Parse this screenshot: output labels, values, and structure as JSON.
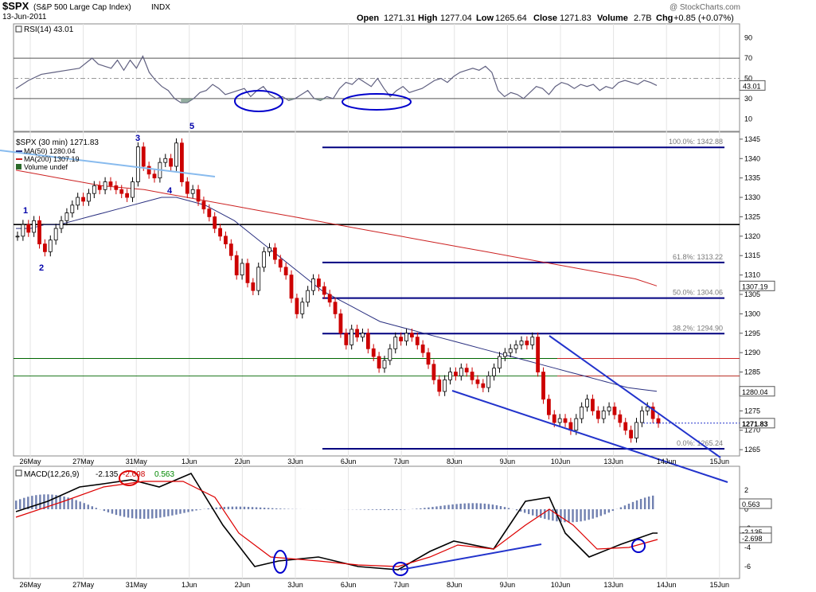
{
  "header": {
    "symbol": "$SPX",
    "name": "(S&P 500 Large Cap Index)",
    "exchange": "INDX",
    "date": "13-Jun-2011",
    "watermark": "@ StockCharts.com",
    "ohlc_text": {
      "open_label": "Open",
      "open": "1271.31",
      "high_label": "High",
      "high": "1277.04",
      "low_label": "Low",
      "low": "1265.64",
      "close_label": "Close",
      "close": "1271.83",
      "volume_label": "Volume",
      "volume": "2.7B",
      "chg_label": "Chg",
      "chg": "+0.85 (+0.07%)"
    }
  },
  "colors": {
    "up": "#000000",
    "down": "#cc0000",
    "ma50": "#2a3080",
    "ma200": "#cc2222",
    "fib": "#000080",
    "trend": "#2233cc",
    "oldtrend": "#88bbee",
    "rsi": "#606080",
    "rsi_fill": "#7a9a8a",
    "macd": "#000000",
    "signal": "#dd0000",
    "hist": "#7080b0",
    "annot_red": "#dd0000",
    "annot_blue": "#0000cc"
  },
  "chart_data": [
    {
      "type": "line",
      "panel": "rsi",
      "legend": "RSI(14) 43.01",
      "ylim": [
        0,
        100
      ],
      "yticks": [
        10,
        30,
        50,
        70,
        90
      ],
      "levels": [
        30,
        50,
        70
      ],
      "last_value": "43.01",
      "x_index": [
        0,
        4,
        8,
        12,
        16,
        20,
        24,
        26,
        28,
        30,
        32,
        34,
        36,
        38,
        40,
        42,
        44,
        46,
        48,
        50,
        52,
        54,
        56,
        58,
        60,
        62,
        64,
        66,
        68,
        70,
        72,
        74,
        76,
        78,
        80,
        82,
        84,
        86,
        88,
        90,
        92,
        94,
        96,
        98,
        100,
        102,
        104,
        106,
        108,
        110,
        112,
        114,
        116,
        118,
        120,
        122,
        124,
        126,
        128,
        130,
        132,
        134,
        136,
        138,
        140,
        142,
        144,
        146,
        148,
        150,
        152,
        154,
        156,
        158,
        160,
        162,
        164,
        166,
        168,
        170,
        172,
        174,
        176,
        178,
        180,
        182,
        184,
        186,
        188,
        190,
        192,
        194,
        196,
        198,
        200,
        202
      ],
      "values": [
        40,
        48,
        54,
        56,
        58,
        60,
        70,
        64,
        62,
        60,
        68,
        58,
        68,
        60,
        72,
        56,
        48,
        42,
        38,
        30,
        26,
        26,
        30,
        36,
        38,
        44,
        40,
        34,
        36,
        38,
        40,
        32,
        38,
        42,
        34,
        30,
        32,
        28,
        30,
        34,
        38,
        30,
        28,
        32,
        30,
        40,
        46,
        44,
        50,
        46,
        42,
        50,
        40,
        32,
        38,
        42,
        36,
        38,
        40,
        44,
        48,
        50,
        46,
        52,
        56,
        58,
        60,
        58,
        62,
        56,
        38,
        32,
        36,
        34,
        30,
        36,
        42,
        40,
        34,
        42,
        46,
        44,
        40,
        44,
        42,
        44,
        38,
        42,
        40,
        46,
        48,
        46,
        44,
        48,
        46,
        43
      ]
    },
    {
      "type": "candlestick",
      "panel": "price",
      "title": "$SPX (30 min) 1271.83",
      "legend": [
        {
          "label": "MA(50) 1280.04"
        },
        {
          "label": "MA(200) 1307.19"
        },
        {
          "label": "Volume undef"
        }
      ],
      "ylim": [
        1264,
        1346
      ],
      "yticks": [
        1265,
        1270,
        1275,
        1280,
        1285,
        1290,
        1295,
        1300,
        1305,
        1310,
        1315,
        1320,
        1325,
        1330,
        1335,
        1340,
        1345
      ],
      "x_labels": [
        "26May",
        "27May",
        "31May",
        "1Jun",
        "2Jun",
        "3Jun",
        "6Jun",
        "7Jun",
        "8Jun",
        "9Jun",
        "10Jun",
        "13Jun",
        "14Jun",
        "15Jun"
      ],
      "x_label_index": [
        0,
        13,
        26,
        39,
        52,
        65,
        78,
        91,
        104,
        117,
        130,
        143,
        156,
        169
      ],
      "close": [
        1320,
        1323,
        1321,
        1324,
        1318,
        1316,
        1319,
        1322,
        1324,
        1326,
        1328,
        1330,
        1329,
        1331,
        1333,
        1332,
        1334,
        1333,
        1332,
        1331,
        1330,
        1334,
        1343,
        1338,
        1336,
        1335,
        1339,
        1340,
        1338,
        1344,
        1334,
        1331,
        1332,
        1329,
        1327,
        1325,
        1322,
        1320,
        1318,
        1315,
        1310,
        1313,
        1308,
        1306,
        1312,
        1316,
        1317,
        1314,
        1312,
        1310,
        1304,
        1300,
        1303,
        1306,
        1309,
        1307,
        1305,
        1303,
        1300,
        1295,
        1292,
        1296,
        1294,
        1295,
        1291,
        1289,
        1286,
        1288,
        1291,
        1294,
        1293,
        1295,
        1294,
        1292,
        1290,
        1287,
        1283,
        1280,
        1283,
        1285,
        1284,
        1286,
        1285,
        1283,
        1282,
        1281,
        1284,
        1286,
        1289,
        1290,
        1291,
        1292,
        1293,
        1292,
        1294,
        1285,
        1278,
        1274,
        1272,
        1273,
        1272,
        1270,
        1273,
        1276,
        1278,
        1275,
        1273,
        1275,
        1276,
        1274,
        1272,
        1270,
        1268,
        1272,
        1275,
        1276,
        1273,
        1271.83
      ],
      "ma50": [
        1322,
        1322,
        1323,
        1323,
        1324,
        1325,
        1326,
        1327,
        1328,
        1329,
        1330,
        1330,
        1329,
        1328,
        1326,
        1324,
        1321,
        1318,
        1315,
        1312,
        1309,
        1306,
        1304,
        1302,
        1300,
        1298,
        1297,
        1296,
        1295,
        1294,
        1293,
        1292,
        1291,
        1290,
        1289,
        1288,
        1287,
        1286,
        1285,
        1284,
        1283,
        1282,
        1281,
        1280.5,
        1280.04
      ],
      "ma200": [
        1337,
        1336,
        1335,
        1334,
        1333,
        1332.5,
        1332,
        1331,
        1330,
        1329,
        1328,
        1327,
        1326,
        1325,
        1324,
        1323,
        1322,
        1321,
        1320,
        1319,
        1318,
        1317,
        1316,
        1315,
        1314,
        1313,
        1312,
        1311,
        1310,
        1309,
        1307.19
      ],
      "fibonacci": [
        {
          "label": "100.0%: 1342.88",
          "value": 1342.88
        },
        {
          "label": "61.8%: 1313.22",
          "value": 1313.22
        },
        {
          "label": "50.0%: 1304.06",
          "value": 1304.06
        },
        {
          "label": "38.2%: 1294.90",
          "value": 1294.9
        },
        {
          "label": "0.0%: 1265.24",
          "value": 1265.24
        }
      ],
      "horizontal_lines": [
        {
          "value": 1323,
          "color": "#000000"
        },
        {
          "value": 1288.5,
          "color": "#006600"
        },
        {
          "value": 1284,
          "color": "#006600"
        },
        {
          "value": 1288.5,
          "color": "#cc2222"
        },
        {
          "value": 1284,
          "color": "#cc2222"
        }
      ],
      "wave_labels": [
        "1",
        "2",
        "3",
        "4",
        "5"
      ],
      "price_tags": [
        {
          "label": "1307.19",
          "value": 1307.19
        },
        {
          "label": "1280.04",
          "value": 1280.04
        },
        {
          "label": "1271.83",
          "value": 1271.83
        }
      ]
    },
    {
      "type": "line",
      "panel": "macd",
      "legend": {
        "name": "MACD(12,26,9)",
        "macd": "-2.135",
        "signal": "-2.698",
        "hist": "0.563"
      },
      "ylim": [
        -7,
        4
      ],
      "yticks": [
        2,
        0,
        -2,
        -4,
        -6
      ],
      "tags": [
        "0.563",
        "-2.135",
        "-2.698"
      ]
    }
  ]
}
